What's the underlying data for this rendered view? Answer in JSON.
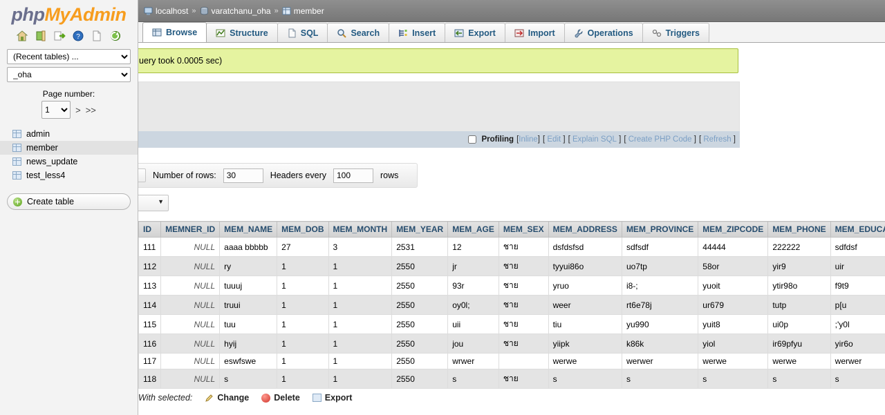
{
  "sidebar": {
    "logo": {
      "php": "php",
      "my": "My",
      "admin": "Admin"
    },
    "icons": [
      {
        "name": "home-icon",
        "title": "Home"
      },
      {
        "name": "server-exit-icon",
        "title": "Server"
      },
      {
        "name": "logout-icon",
        "title": "Log out"
      },
      {
        "name": "help-icon",
        "title": "phpMyAdmin documentation"
      },
      {
        "name": "docs-icon",
        "title": "Documentation"
      },
      {
        "name": "reload-icon",
        "title": "Reload navigation"
      }
    ],
    "recent_tables_select": "(Recent tables) ...",
    "database_select": "_oha",
    "page_number_label": "Page number:",
    "page_number_value": "1",
    "page_next": ">",
    "page_last": ">>",
    "tables": [
      {
        "label": "admin",
        "active": false
      },
      {
        "label": "member",
        "active": true
      },
      {
        "label": "news_update",
        "active": false
      },
      {
        "label": "test_less4",
        "active": false
      }
    ],
    "create_table_label": "Create table"
  },
  "breadcrumb": {
    "server": "localhost",
    "database": "varatchanu_oha",
    "table": "member",
    "separator": "»"
  },
  "tabs": [
    {
      "label": "Browse",
      "icon": "browse-icon",
      "active": true
    },
    {
      "label": "Structure",
      "icon": "structure-icon",
      "active": false
    },
    {
      "label": "SQL",
      "icon": "sql-icon",
      "active": false
    },
    {
      "label": "Search",
      "icon": "search-icon",
      "active": false
    },
    {
      "label": "Insert",
      "icon": "insert-icon",
      "active": false
    },
    {
      "label": "Export",
      "icon": "export-icon",
      "active": false
    },
    {
      "label": "Import",
      "icon": "import-icon",
      "active": false
    },
    {
      "label": "Operations",
      "icon": "operations-icon",
      "active": false
    },
    {
      "label": "Triggers",
      "icon": "triggers-icon",
      "active": false
    }
  ],
  "message": {
    "text": "uery took 0.0005 sec)"
  },
  "sqlbar": {
    "profiling_label": "Profiling",
    "links": [
      {
        "label": "Inline",
        "open": "[",
        "close": "]"
      },
      {
        "label": "Edit",
        "open": "[",
        "close": "]"
      },
      {
        "label": "Explain SQL",
        "open": "[",
        "close": "]"
      },
      {
        "label": "Create PHP Code",
        "open": "[",
        "close": "]"
      },
      {
        "label": "Refresh",
        "open": "[",
        "close": "]"
      }
    ]
  },
  "row_options": {
    "number_of_rows_label": "Number of rows:",
    "number_of_rows_value": "30",
    "headers_every_label": "Headers every",
    "headers_every_value": "100",
    "rows_label": "rows"
  },
  "table": {
    "columns": [
      "ID",
      "MEMNER_ID",
      "MEM_NAME",
      "MEM_DOB",
      "MEM_MONTH",
      "MEM_YEAR",
      "MEM_AGE",
      "MEM_SEX",
      "MEM_ADDRESS",
      "MEM_PROVINCE",
      "MEM_ZIPCODE",
      "MEM_PHONE",
      "MEM_EDUCA"
    ],
    "rows": [
      [
        "111",
        "NULL",
        "aaaa bbbbb",
        "27",
        "3",
        "2531",
        "12",
        "ชาย",
        "dsfdsfsd",
        "sdfsdf",
        "44444",
        "222222",
        "sdfdsf"
      ],
      [
        "112",
        "NULL",
        "ry",
        "1",
        "1",
        "2550",
        "jr",
        "ชาย",
        "tyyui86o",
        "uo7tp",
        "58or",
        "yir9",
        "uir"
      ],
      [
        "113",
        "NULL",
        "tuuuj",
        "1",
        "1",
        "2550",
        "93r",
        "ชาย",
        "yruo",
        "i8-;",
        "yuoit",
        "ytir98o",
        "f9t9"
      ],
      [
        "114",
        "NULL",
        "truui",
        "1",
        "1",
        "2550",
        "oy0l;",
        "ชาย",
        "weer",
        "rt6e78j",
        "ur679",
        "tutp",
        "p[u"
      ],
      [
        "115",
        "NULL",
        "tuu",
        "1",
        "1",
        "2550",
        "uii",
        "ชาย",
        "tiu",
        "yu990",
        "yuit8",
        "ui0p",
        ";'y0l"
      ],
      [
        "116",
        "NULL",
        "hyij",
        "1",
        "1",
        "2550",
        "jou",
        "ชาย",
        "yiipk",
        "k86k",
        "yiol",
        "ir69pfyu",
        "yir6o"
      ],
      [
        "117",
        "NULL",
        "eswfswe",
        "1",
        "1",
        "2550",
        "wrwer",
        "",
        "werwe",
        "werwer",
        "werwe",
        "werwe",
        "werwer"
      ],
      [
        "118",
        "NULL",
        "s",
        "1",
        "1",
        "2550",
        "s",
        "ชาย",
        "s",
        "s",
        "s",
        "s",
        "s"
      ]
    ]
  },
  "with_selected": {
    "label": "With selected:",
    "actions": [
      {
        "label": "Change",
        "icon": "pencil-icon"
      },
      {
        "label": "Delete",
        "icon": "delete-icon"
      },
      {
        "label": "Export",
        "icon": "export-icon"
      }
    ]
  },
  "colors": {
    "accent_orange": "#f79d1e",
    "logo_blue": "#6b6f8d",
    "tab_text": "#235a81",
    "success_bg": "#e5f3a0",
    "success_border": "#a6bf3e",
    "sqlbar_bg": "#ccd6e0",
    "header_text": "#274d6e",
    "row_even": "#e4e4e4"
  }
}
